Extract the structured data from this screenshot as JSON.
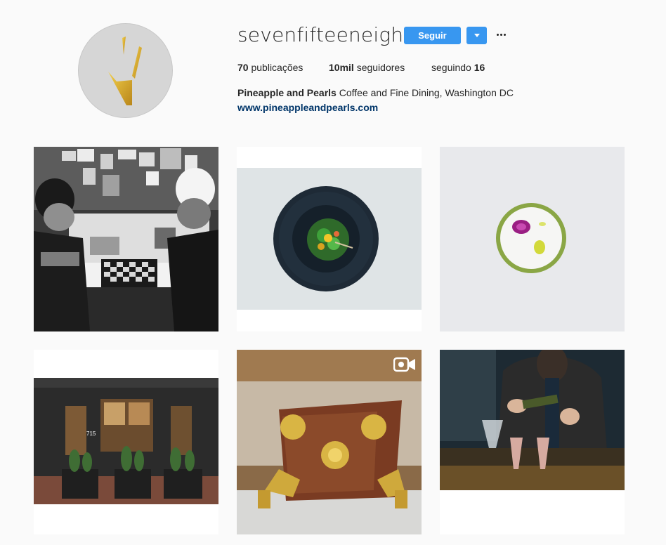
{
  "profile": {
    "username": "sevenfifteeneighth",
    "follow_label": "Seguir",
    "dropdown_icon": "caret-down-icon",
    "more_icon": "ellipsis-icon",
    "stats": {
      "posts_count": "70",
      "posts_label": "publicações",
      "followers_count": "10mil",
      "followers_label": "seguidores",
      "following_label": "seguindo",
      "following_count": "16"
    },
    "bio_name": "Pineapple and Pearls",
    "bio_text": "Coffee and Fine Dining, Washington DC",
    "website": "www.pineappleandpearls.com"
  },
  "posts": [
    {
      "id": 1,
      "subject": "two men playing chess (black and white)"
    },
    {
      "id": 2,
      "subject": "dark plate with green dish"
    },
    {
      "id": 3,
      "subject": "white plate with flower garnish"
    },
    {
      "id": 4,
      "subject": "storefront with planters",
      "door_number": "715"
    },
    {
      "id": 5,
      "subject": "espresso machine",
      "badge": "video-icon"
    },
    {
      "id": 6,
      "subject": "bartender pouring drinks"
    }
  ],
  "colors": {
    "accent": "#3897f0",
    "link": "#003569",
    "avatar_bg": "#d6d6d6",
    "logo_gold": "#d9a825"
  }
}
